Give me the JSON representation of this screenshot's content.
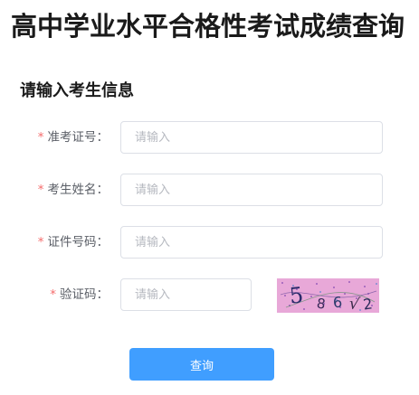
{
  "page": {
    "title": "高中学业水平合格性考试成绩查询",
    "section_title": "请输入考生信息"
  },
  "form": {
    "required_mark": "*",
    "fields": [
      {
        "label": "准考证号：",
        "value": "",
        "placeholder": "请输入"
      },
      {
        "label": "考生姓名：",
        "value": "",
        "placeholder": "请输入"
      },
      {
        "label": "证件号码：",
        "value": "",
        "placeholder": "请输入"
      },
      {
        "label": "验证码：",
        "value": "",
        "placeholder": "请输入"
      }
    ],
    "captcha": {
      "characters": "5 8 6 √2",
      "background": "#e8a8d8"
    },
    "submit_label": "查询"
  },
  "colors": {
    "primary": "#409eff",
    "required": "#f56c6c",
    "label": "#5a5e66",
    "border": "#dcdfe6"
  }
}
